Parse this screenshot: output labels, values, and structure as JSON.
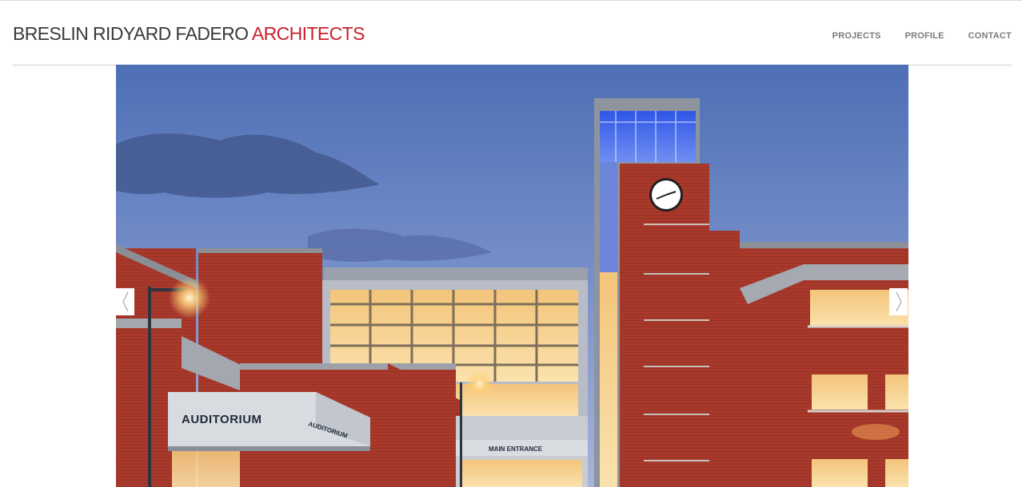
{
  "brand": {
    "name_main": "BRESLIN RIDYARD FADERO ",
    "name_accent": "ARCHITECTS",
    "text_color": "#3a3a3a",
    "accent_color": "#c8202c"
  },
  "nav": {
    "items": [
      {
        "label": "PROJECTS"
      },
      {
        "label": "PROFILE"
      },
      {
        "label": "CONTACT"
      }
    ]
  },
  "slideshow": {
    "photo_signs": {
      "auditorium_large": "AUDITORIUM",
      "auditorium_side": "AUDITORIUM",
      "main_entrance": "MAIN ENTRANCE"
    },
    "prev_icon": "chevron-left-icon",
    "next_icon": "chevron-right-icon"
  }
}
